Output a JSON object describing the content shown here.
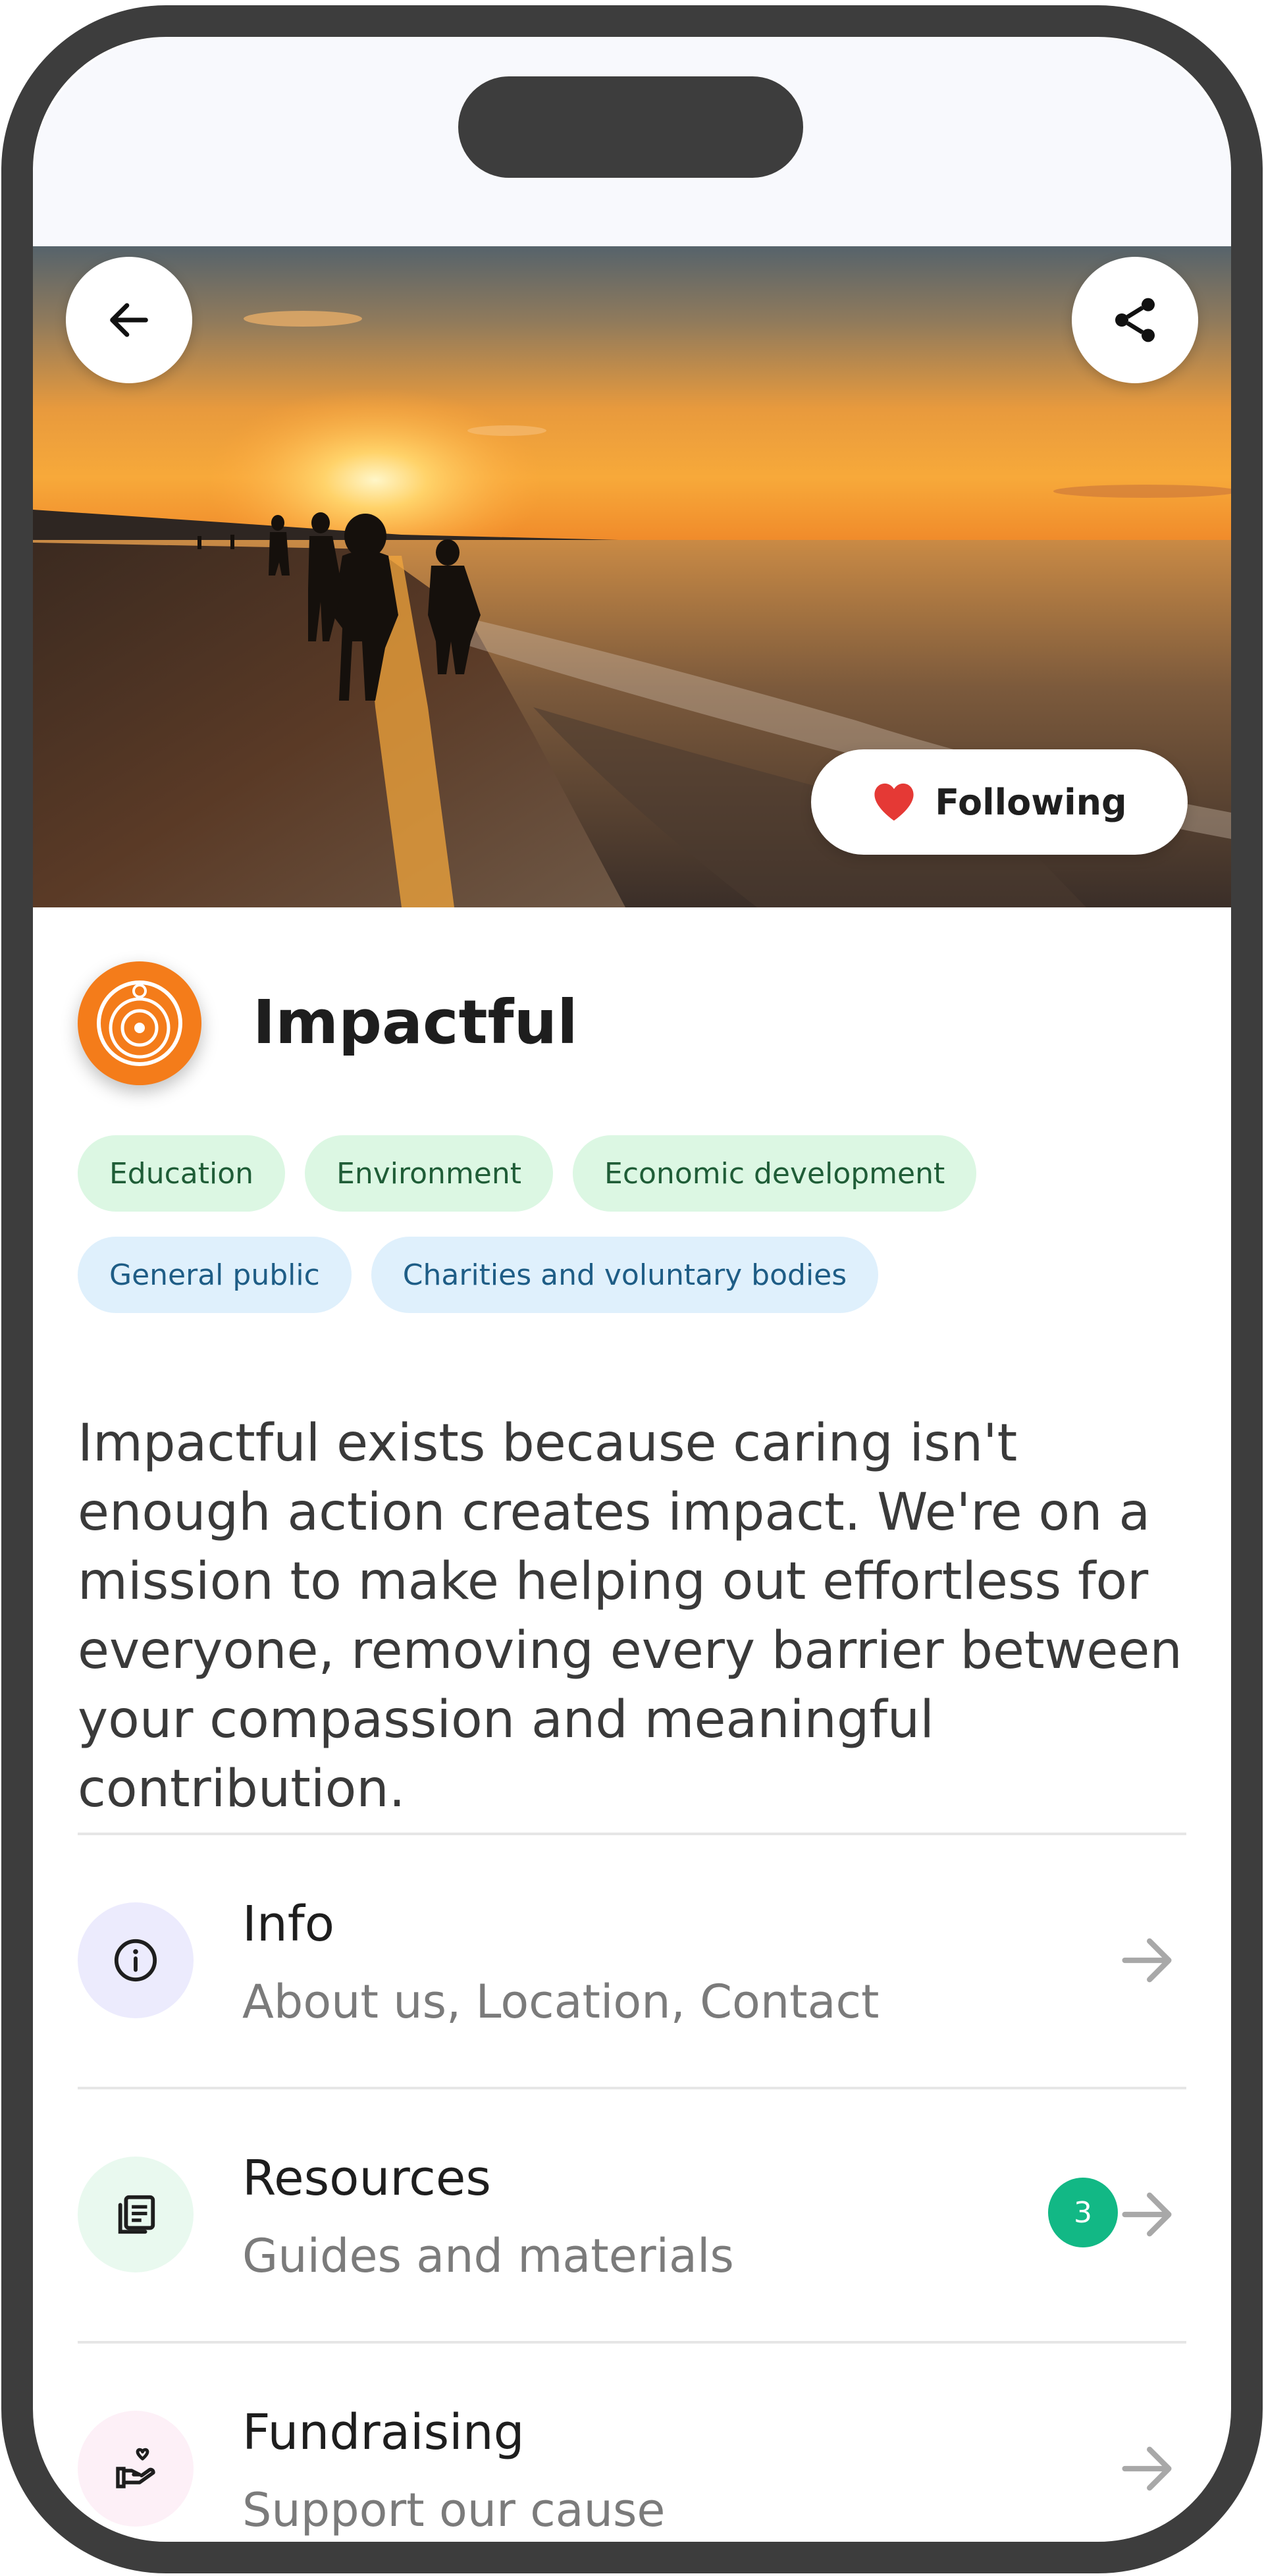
{
  "header": {
    "back_icon": "arrow-left-icon",
    "share_icon": "share-icon"
  },
  "follow": {
    "label": "Following",
    "icon": "heart-icon",
    "heart_color": "#e53935"
  },
  "org": {
    "name": "Impactful",
    "avatar_icon": "target-rings-icon",
    "brand_color": "#f47c1a",
    "cause_tags": [
      "Education",
      "Environment",
      "Economic development"
    ],
    "audience_tags": [
      "General public",
      "Charities and voluntary bodies"
    ],
    "description": "Impactful exists because caring isn't enough action creates impact. We're on a mission to make helping out effortless for everyone, removing every barrier between your compassion and meaningful contribution."
  },
  "menu": [
    {
      "title": "Info",
      "subtitle": "About us, Location, Contact",
      "icon": "info-icon",
      "icon_bg": "#ecebfd"
    },
    {
      "title": "Resources",
      "subtitle": "Guides and materials",
      "icon": "document-icon",
      "icon_bg": "#e9f9ef",
      "badge": "3"
    },
    {
      "title": "Fundraising",
      "subtitle": "Support our cause",
      "icon": "hand-heart-icon",
      "icon_bg": "#fdf0f7"
    }
  ]
}
